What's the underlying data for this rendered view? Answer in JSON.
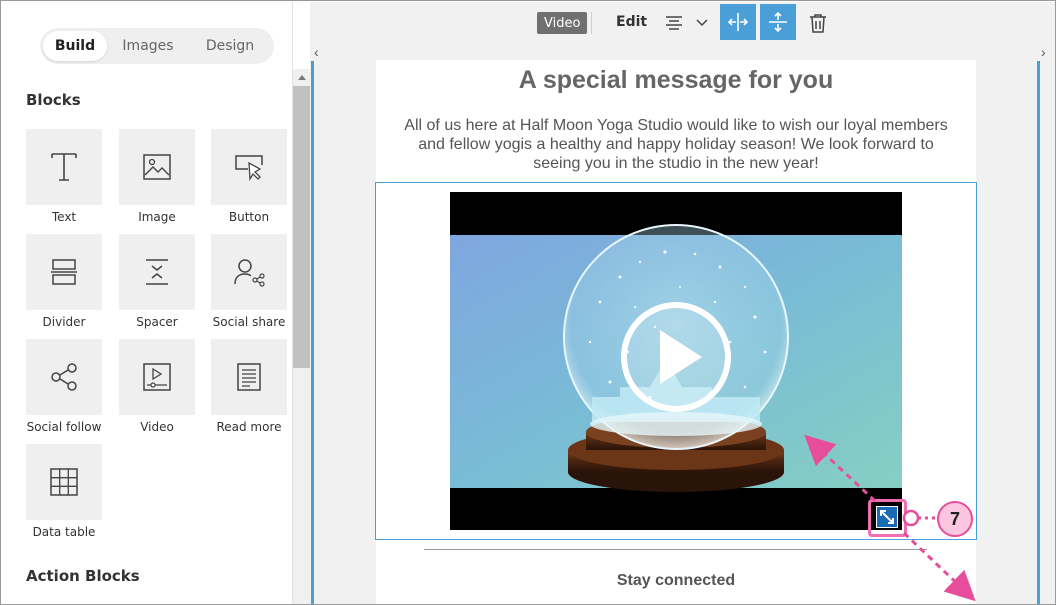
{
  "sidebar": {
    "tabs": [
      {
        "label": "Build",
        "active": true
      },
      {
        "label": "Images",
        "active": false
      },
      {
        "label": "Design",
        "active": false
      }
    ],
    "blocks_heading": "Blocks",
    "blocks": [
      {
        "label": "Text",
        "icon": "text-icon"
      },
      {
        "label": "Image",
        "icon": "image-icon"
      },
      {
        "label": "Button",
        "icon": "button-icon"
      },
      {
        "label": "Divider",
        "icon": "divider-icon"
      },
      {
        "label": "Spacer",
        "icon": "spacer-icon"
      },
      {
        "label": "Social share",
        "icon": "social-share-icon"
      },
      {
        "label": "Social follow",
        "icon": "social-follow-icon"
      },
      {
        "label": "Video",
        "icon": "video-icon"
      },
      {
        "label": "Read more",
        "icon": "read-more-icon"
      },
      {
        "label": "Data table",
        "icon": "data-table-icon"
      }
    ],
    "action_heading": "Action Blocks"
  },
  "toolbar": {
    "badge": "Video",
    "edit_label": "Edit",
    "align_icon": "align-center-icon",
    "dropdown_icon": "chevron-down-icon",
    "fit_width_icon": "fit-width-icon",
    "fit_height_icon": "fit-height-icon",
    "delete_icon": "trash-icon",
    "nav_left": "‹",
    "nav_right": "›"
  },
  "email": {
    "title": "A special message for you",
    "body": "All of us here at Half Moon Yoga Studio would like to wish our loyal members and fellow yogis a healthy and happy holiday season! We look forward to seeing you in the studio in the new year!",
    "footer_heading": "Stay connected"
  },
  "annotation": {
    "step_number": "7"
  },
  "colors": {
    "accent": "#4a9fd8",
    "callout": "#e64d9a",
    "handle": "#1a6bb5"
  }
}
